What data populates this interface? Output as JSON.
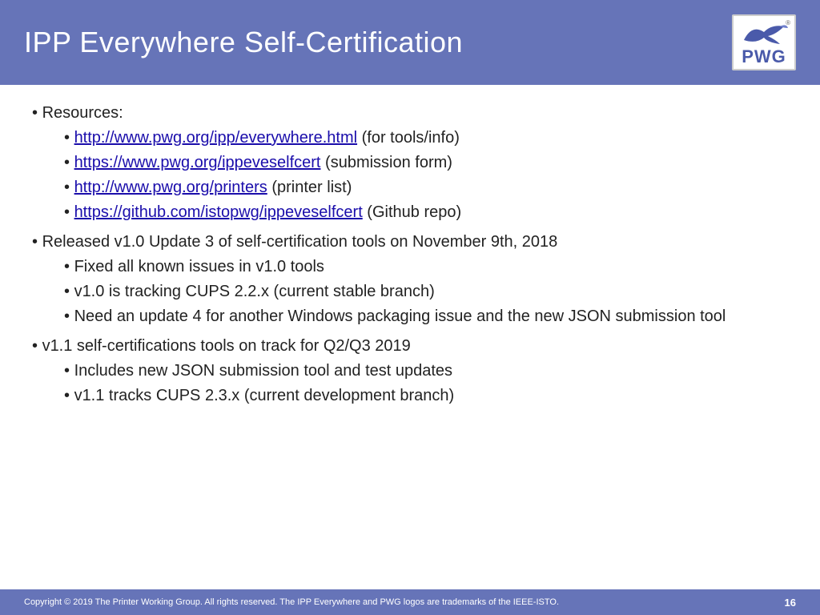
{
  "header": {
    "title": "IPP Everywhere Self-Certification"
  },
  "content": {
    "bullet1_label": "Resources:",
    "links": [
      {
        "url": "http://www.pwg.org/ipp/everywhere.html",
        "suffix": " (for tools/info)"
      },
      {
        "url": "https://www.pwg.org/ippeveselfcert",
        "suffix": " (submission form)"
      },
      {
        "url": "http://www.pwg.org/printers",
        "suffix": " (printer list)"
      },
      {
        "url": "https://github.com/istopwg/ippeveselfcert",
        "suffix": " (Github repo)"
      }
    ],
    "bullet2_label": "Released v1.0 Update 3 of self-certification tools on November 9th, 2018",
    "bullet2_sub": [
      "Fixed all known issues in v1.0 tools",
      "v1.0 is tracking CUPS 2.2.x (current stable branch)",
      "Need an update 4 for another Windows packaging issue and the new JSON submission tool"
    ],
    "bullet3_label": "v1.1 self-certifications tools on track for Q2/Q3 2019",
    "bullet3_sub": [
      "Includes new JSON submission tool and test updates",
      "v1.1 tracks CUPS 2.3.x (current development branch)"
    ]
  },
  "footer": {
    "copyright": "Copyright © 2019 The Printer Working Group. All rights reserved. The IPP Everywhere and PWG logos are trademarks of the IEEE-ISTO.",
    "page_number": "16"
  },
  "logo": {
    "text": "PWG",
    "reg": "®"
  }
}
